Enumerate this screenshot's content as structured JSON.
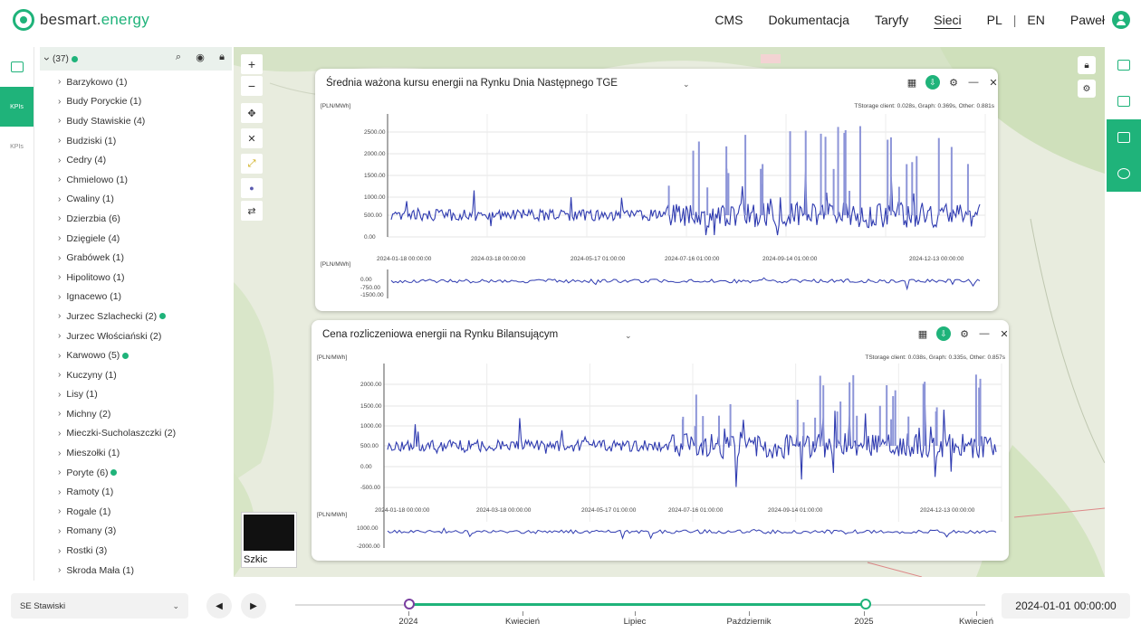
{
  "header": {
    "logo_main": "besmart.",
    "logo_accent": "energy",
    "nav": [
      "CMS",
      "Dokumentacja",
      "Taryfy",
      "Sieci"
    ],
    "nav_active": "Sieci",
    "lang_pl": "PL",
    "lang_sep": "|",
    "lang_en": "EN",
    "user_name": "Paweł"
  },
  "rail": {
    "items": [
      "",
      "KPIs",
      "KPIs"
    ]
  },
  "tree": {
    "root_count": "(37)",
    "items": [
      {
        "label": "Barzykowo (1)",
        "dot": false
      },
      {
        "label": "Budy Poryckie (1)",
        "dot": false
      },
      {
        "label": "Budy Stawiskie (4)",
        "dot": false
      },
      {
        "label": "Budziski (1)",
        "dot": false
      },
      {
        "label": "Cedry (4)",
        "dot": false
      },
      {
        "label": "Chmielowo (1)",
        "dot": false
      },
      {
        "label": "Cwaliny (1)",
        "dot": false
      },
      {
        "label": "Dzierzbia (6)",
        "dot": false
      },
      {
        "label": "Dzięgiele (4)",
        "dot": false
      },
      {
        "label": "Grabówek (1)",
        "dot": false
      },
      {
        "label": "Hipolitowo (1)",
        "dot": false
      },
      {
        "label": "Ignacewo (1)",
        "dot": false
      },
      {
        "label": "Jurzec Szlachecki (2)",
        "dot": true
      },
      {
        "label": "Jurzec Włościański (2)",
        "dot": false
      },
      {
        "label": "Karwowo (5)",
        "dot": true
      },
      {
        "label": "Kuczyny (1)",
        "dot": false
      },
      {
        "label": "Lisy (1)",
        "dot": false
      },
      {
        "label": "Michny (2)",
        "dot": false
      },
      {
        "label": "Mieczki-Sucholaszczki (2)",
        "dot": false
      },
      {
        "label": "Mieszołki (1)",
        "dot": false
      },
      {
        "label": "Poryte (6)",
        "dot": true
      },
      {
        "label": "Ramoty (1)",
        "dot": false
      },
      {
        "label": "Rogale (1)",
        "dot": false
      },
      {
        "label": "Romany (3)",
        "dot": false
      },
      {
        "label": "Rostki (3)",
        "dot": false
      },
      {
        "label": "Skroda Mała (1)",
        "dot": false
      }
    ]
  },
  "map": {
    "sketch_label": "Szkic",
    "controls": [
      "+",
      "−",
      "✥",
      "✕",
      "⤢",
      "●",
      "⇄"
    ]
  },
  "panel1": {
    "title": "Średnia ważona kursu energii na Rynku Dnia Następnego TGE",
    "unit": "[PLN/MWh]",
    "stats": "TStorage client: 0.028s, Graph: 0.369s, Other: 0.881s"
  },
  "panel2": {
    "title": "Cena rozliczeniowa energii na Rynku Bilansującym",
    "unit": "[PLN/MWh]",
    "stats": "TStorage client: 0.038s, Graph: 0.335s, Other: 0.857s"
  },
  "chart_data": [
    {
      "type": "line",
      "title": "Średnia ważona kursu energii na Rynku Dnia Następnego TGE",
      "ylabel": "[PLN/MWh]",
      "yticks": [
        "2500.00",
        "2000.00",
        "1500.00",
        "1000.00",
        "500.00",
        "0.00"
      ],
      "ylim": [
        -150,
        2800
      ],
      "xticks": [
        "2024-01-18 00:00:00",
        "2024-03-18 00:00:00",
        "2024-05-17 01:00:00",
        "2024-07-16 01:00:00",
        "2024-09-14 01:00:00",
        "2024-12-13 00:00:00"
      ],
      "series": [
        {
          "color": "#2f3bb0"
        }
      ],
      "overview": {
        "ylabel": "[PLN/MWh]",
        "yticks": [
          "0.00",
          "-750.00",
          "-1500.00"
        ]
      }
    },
    {
      "type": "line",
      "title": "Cena rozliczeniowa energii na Rynku Bilansującym",
      "ylabel": "[PLN/MWh]",
      "yticks": [
        "2000.00",
        "1500.00",
        "1000.00",
        "500.00",
        "0.00",
        "-500.00"
      ],
      "ylim": [
        -700,
        2300
      ],
      "xticks": [
        "2024-01-18 00:00:00",
        "2024-03-18 00:00:00",
        "2024-05-17 01:00:00",
        "2024-07-16 01:00:00",
        "2024-09-14 01:00:00",
        "2024-12-13 00:00:00"
      ],
      "series": [
        {
          "color": "#2f3bb0"
        }
      ],
      "overview": {
        "ylabel": "[PLN/MWh]",
        "yticks": [
          "1000.00",
          "-2000.00"
        ]
      }
    }
  ],
  "bottom": {
    "selector_value": "SE Stawiski",
    "date_value": "2024-01-01 00:00:00",
    "timeline_labels": [
      "2024",
      "Kwiecień",
      "Lipiec",
      "Październik",
      "2025",
      "Kwiecień"
    ]
  },
  "colors": {
    "accent": "#1fb37a",
    "series": "#2f3bb0"
  }
}
